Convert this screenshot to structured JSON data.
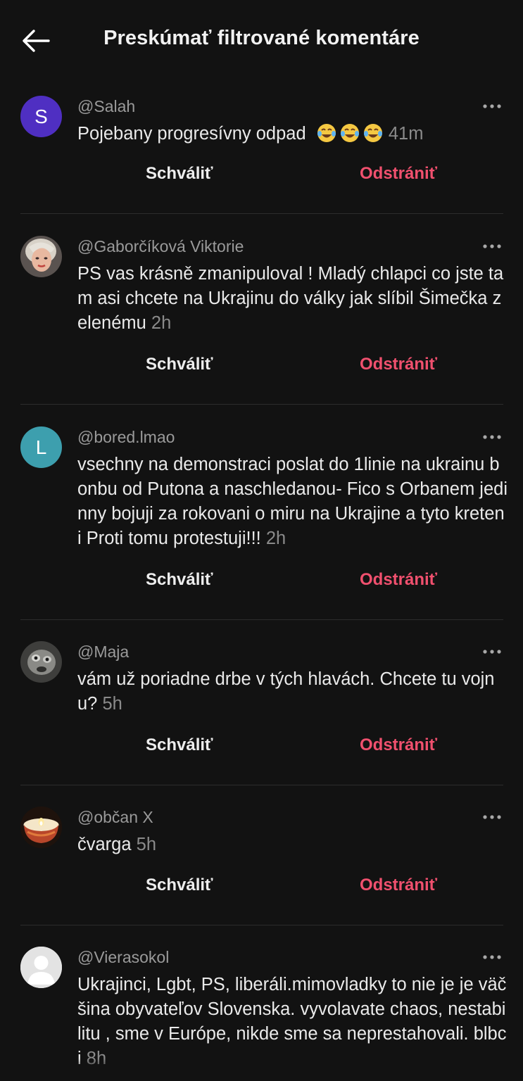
{
  "header": {
    "title": "Preskúmať filtrované komentáre",
    "back_icon": "arrow-left-icon"
  },
  "actions": {
    "approve_label": "Schváliť",
    "remove_label": "Odstrániť"
  },
  "colors": {
    "background": "#121212",
    "remove": "#f0506e",
    "muted": "#9a9a9a"
  },
  "comments": [
    {
      "handle": "@Salah",
      "avatar_letter": "S",
      "avatar_color": "#4f2fc2",
      "text": "Pojebany progresívny odpad",
      "emoji": "face-with-tears-of-joy x3",
      "time": "41m"
    },
    {
      "handle": "@Gaborčíková Viktorie",
      "avatar_letter": "",
      "avatar_color": "#7a6a64",
      "text": "PS vas krásně zmanipuloval ! Mladý chlapci co jste tam asi chcete na Ukrajinu do války jak slíbil Šimečka zelenému",
      "time": "2h"
    },
    {
      "handle": "@bored.lmao",
      "avatar_letter": "L",
      "avatar_color": "#3d9fae",
      "text": "vsechny na demonstraci poslat do 1linie na ukrainu bonbu od Putona a naschledanou- Fico s Orbanem jedinny bojuji za rokovani o miru na Ukrajine a tyto kreteni Proti tomu protestuji!!!",
      "time": "2h"
    },
    {
      "handle": "@Maja",
      "avatar_letter": "",
      "avatar_color": "#4a4a48",
      "text": "vám už poriadne drbe v tých hlavách. Chcete tu vojnu?",
      "time": "5h"
    },
    {
      "handle": "@občan X",
      "avatar_letter": "",
      "avatar_color": "#2a1a12",
      "text": "čvarga",
      "time": "5h"
    },
    {
      "handle": "@Vierasokol",
      "avatar_letter": "",
      "avatar_color": "#e3e3e3",
      "text": "Ukrajinci, Lgbt, PS, liberáli.mimovladky to nie je je väčšina obyvateľov Slovenska. vyvolavate chaos, nestabilitu , sme v Európe, nikde sme sa neprestahovali. blbci",
      "time": "8h"
    }
  ]
}
